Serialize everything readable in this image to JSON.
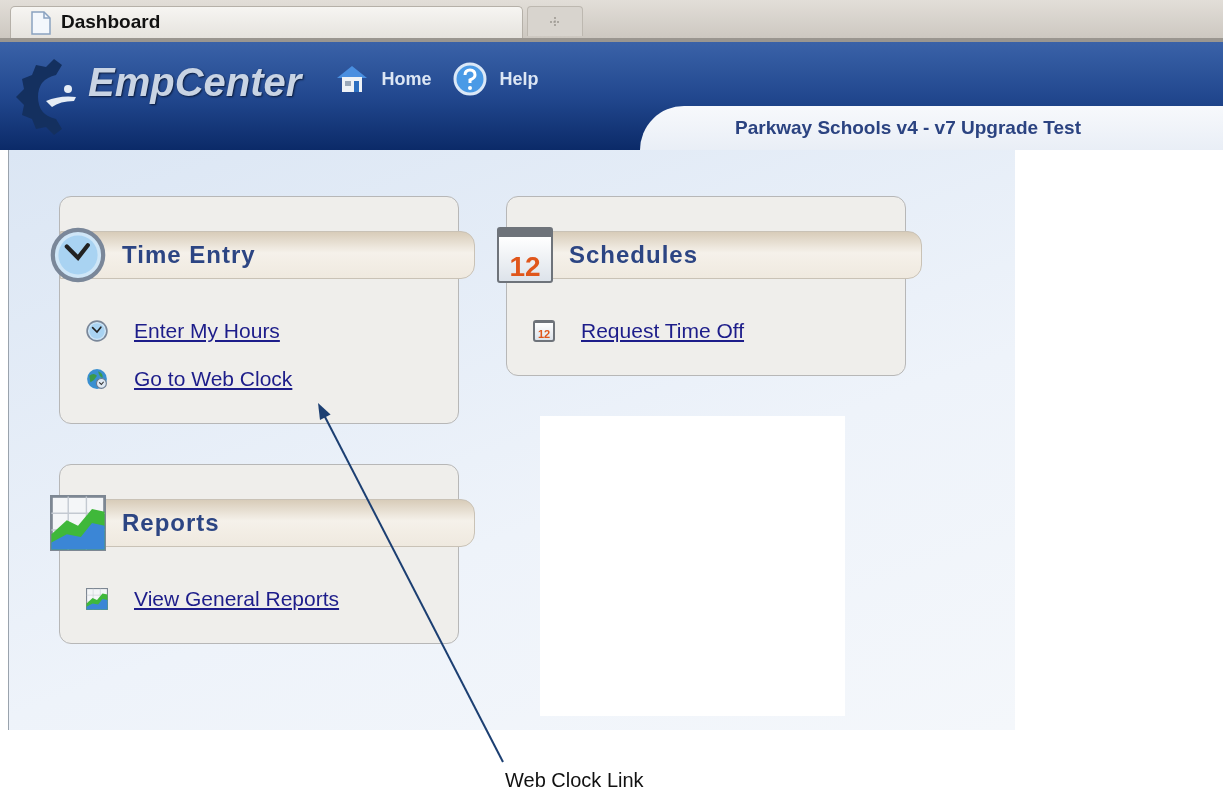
{
  "tabs": [
    {
      "label": "Dashboard",
      "selected": true
    }
  ],
  "header": {
    "logo": "EmpCenter",
    "nav": [
      {
        "label": "Home",
        "kind": "home"
      },
      {
        "label": "Help",
        "kind": "help"
      }
    ],
    "site_title": "Parkway Schools v4 - v7 Upgrade Test"
  },
  "columns": [
    [
      {
        "title": "Time Entry",
        "kind": "clock",
        "links": [
          {
            "label": "Enter My Hours",
            "kind": "clock"
          },
          {
            "label": "Go to Web Clock",
            "kind": "globe"
          }
        ]
      },
      {
        "title": "Reports",
        "kind": "chart",
        "links": [
          {
            "label": "View General Reports",
            "kind": "chart"
          }
        ]
      }
    ],
    [
      {
        "title": "Schedules",
        "kind": "calendar",
        "icon_text": "12",
        "links": [
          {
            "label": "Request Time Off",
            "kind": "calendar",
            "icon_text": "12"
          }
        ]
      }
    ]
  ],
  "annotation": {
    "caption": "Web Clock Link"
  }
}
